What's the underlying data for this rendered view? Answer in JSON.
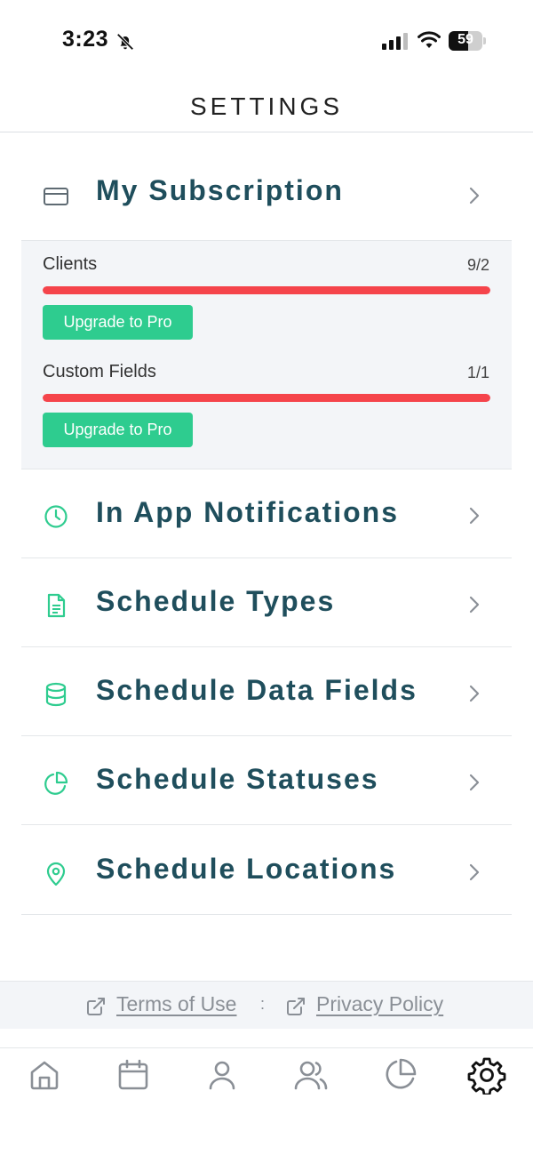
{
  "status_bar": {
    "time": "3:23",
    "battery_level": "59",
    "battery_fraction": 0.59
  },
  "header": {
    "title": "SETTINGS"
  },
  "subscription": {
    "label": "My Subscription",
    "icon": "credit-card-icon",
    "usage": [
      {
        "label": "Clients",
        "value": "9/2",
        "fill_fraction": 1.0,
        "button_label": "Upgrade to Pro"
      },
      {
        "label": "Custom Fields",
        "value": "1/1",
        "fill_fraction": 1.0,
        "button_label": "Upgrade to Pro"
      }
    ]
  },
  "menu": [
    {
      "label": "In App Notifications",
      "icon": "clock-icon"
    },
    {
      "label": "Schedule Types",
      "icon": "document-icon"
    },
    {
      "label": "Schedule Data Fields",
      "icon": "database-icon"
    },
    {
      "label": "Schedule Statuses",
      "icon": "pie-chart-icon"
    },
    {
      "label": "Schedule Locations",
      "icon": "map-pin-icon"
    }
  ],
  "footer": {
    "terms_label": "Terms of Use",
    "separator": ":",
    "privacy_label": "Privacy Policy"
  },
  "tab_bar": {
    "tabs": [
      "home-icon",
      "calendar-icon",
      "user-icon",
      "users-icon",
      "pie-chart-icon",
      "gear-icon"
    ],
    "active": "gear-icon"
  },
  "colors": {
    "accent_green": "#2ecc8f",
    "title_teal": "#1f4e5c",
    "usage_red": "#f5444b",
    "panel_bg": "#f3f5f8"
  }
}
